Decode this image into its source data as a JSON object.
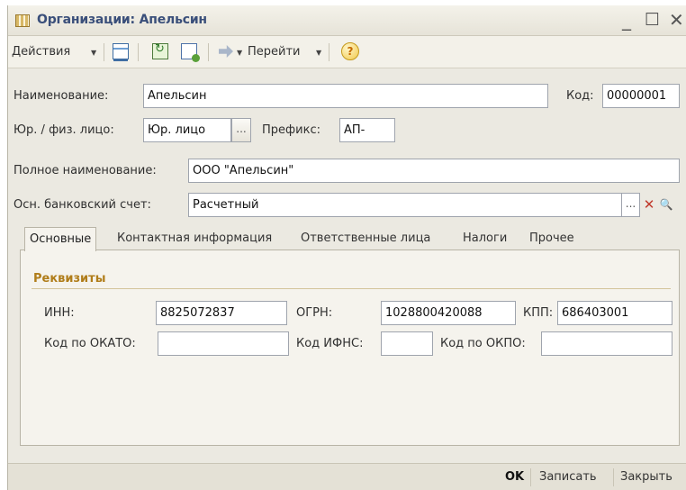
{
  "window": {
    "title": "Организации: Апельсин",
    "controls": {
      "minimize": "_",
      "maximize": "☐",
      "close": "✕"
    }
  },
  "toolbar": {
    "actions_label": "Действия",
    "goto_label": "Перейти",
    "help_glyph": "?",
    "arrow_glyph": "▼"
  },
  "form": {
    "name_label": "Наименование:",
    "name_value": "Апельсин",
    "code_label": "Код:",
    "code_value": "00000001",
    "entity_label": "Юр. / физ. лицо:",
    "entity_value": "Юр. лицо",
    "prefix_label": "Префикс:",
    "prefix_value": "АП-",
    "full_name_label": "Полное наименование:",
    "full_name_value": "ООО \"Апельсин\"",
    "bank_label": "Осн. банковский счет:",
    "bank_value": "Расчетный",
    "select_glyph": "...",
    "clear_glyph": "✕",
    "search_glyph": "🔍"
  },
  "tabs": [
    {
      "label": "Основные",
      "active": true
    },
    {
      "label": "Контактная информация",
      "active": false
    },
    {
      "label": "Ответственные лица",
      "active": false
    },
    {
      "label": "Налоги",
      "active": false
    },
    {
      "label": "Прочее",
      "active": false
    }
  ],
  "requisites": {
    "group_title": "Реквизиты",
    "inn_label": "ИНН:",
    "inn_value": "8825072837",
    "ogrn_label": "ОГРН:",
    "ogrn_value": "1028800420088",
    "kpp_label": "КПП:",
    "kpp_value": "686403001",
    "okato_label": "Код по ОКАТО:",
    "okato_value": "",
    "ifns_label": "Код ИФНС:",
    "ifns_value": "",
    "okpo_label": "Код по ОКПО:",
    "okpo_value": ""
  },
  "footer": {
    "ok_label": "OK",
    "save_label": "Записать",
    "close_label": "Закрыть"
  },
  "colors": {
    "title_text": "#3a4f7a",
    "group_title": "#b07d1a",
    "clear_red": "#c0392b",
    "search_blue": "#2d5f9e"
  }
}
